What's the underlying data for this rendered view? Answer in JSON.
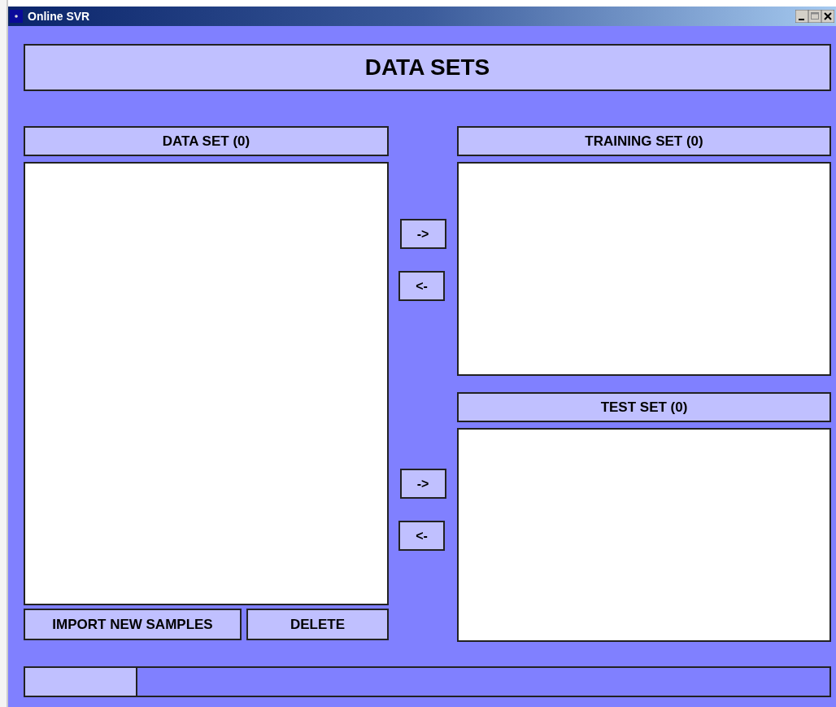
{
  "window": {
    "title": "Online SVR"
  },
  "header": {
    "title": "DATA SETS"
  },
  "data_set": {
    "label": "DATA SET (0)"
  },
  "training_set": {
    "label": "TRAINING SET (0)"
  },
  "test_set": {
    "label": "TEST SET (0)"
  },
  "training_buttons": [
    "->",
    "<-"
  ],
  "test_buttons": [
    "->",
    "<-"
  ],
  "actions": [
    "IMPORT NEW SAMPLES",
    "DELETE"
  ],
  "progress": {
    "level": 0.14
  }
}
